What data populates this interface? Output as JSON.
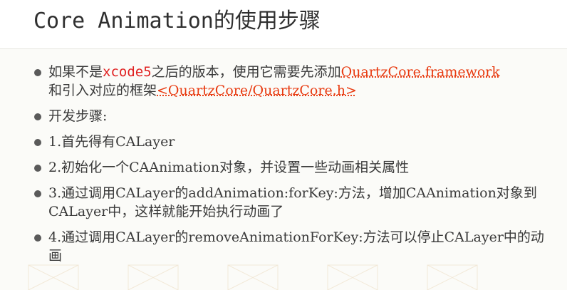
{
  "slide": {
    "title_latin": "Core Animation",
    "title_cjk": "的使用步骤"
  },
  "bullets": [
    {
      "pre": "如果不是",
      "code": "xcode5",
      "mid": "之后的版本，使用它需要先添加",
      "link1": "QuartzCore.framework",
      "mid2": "和引入对应的框架",
      "link2": "<QuartzCore/QuartzCore.h>"
    },
    {
      "text": "开发步骤:"
    },
    {
      "text": "1.首先得有CALayer"
    },
    {
      "text": "2.初始化一个CAAnimation对象，并设置一些动画相关属性"
    },
    {
      "text": "3.通过调用CALayer的addAnimation:forKey:方法，增加CAAnimation对象到CALayer中，这样就能开始执行动画了"
    },
    {
      "text": "4.通过调用CALayer的removeAnimationForKey:方法可以停止CALayer中的动画"
    }
  ],
  "colors": {
    "code": "#e02020",
    "link": "#e83a10",
    "text": "#3a3a3a"
  }
}
